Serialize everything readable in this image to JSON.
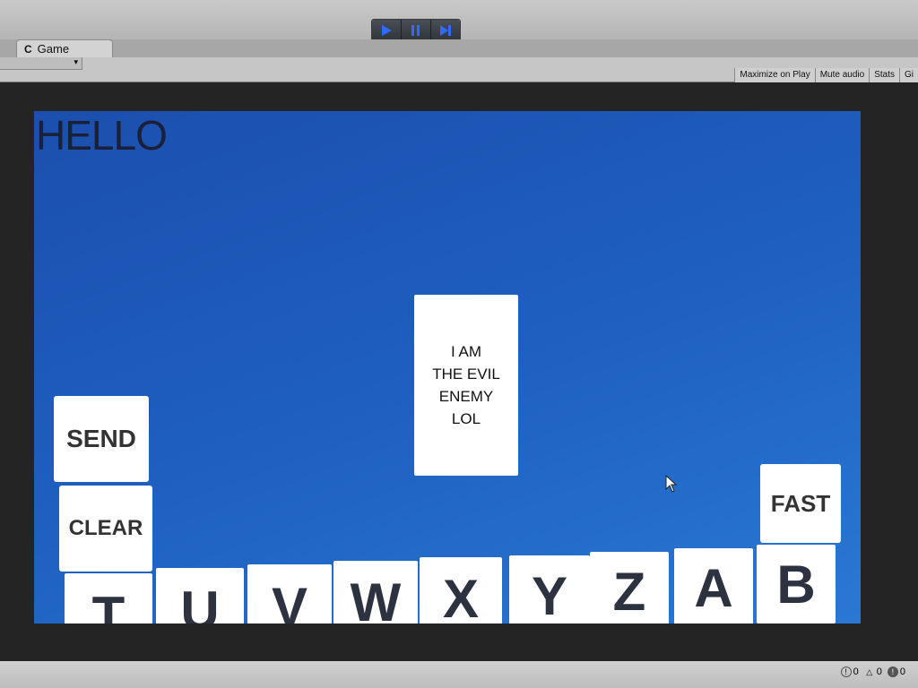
{
  "editor": {
    "tab_label": "Game",
    "toolbar": {
      "aspect_dropdown": "",
      "buttons": [
        "Maximize on Play",
        "Mute audio",
        "Stats",
        "Gi"
      ]
    },
    "play_controls": [
      "play-icon",
      "pause-icon",
      "step-icon"
    ],
    "status_counts": {
      "info": "0",
      "warnings": "0",
      "errors": "0"
    },
    "colors": {
      "accent": "#2f6bff",
      "viewport_top": "#1c4fae",
      "viewport_bottom": "#2b78d4"
    }
  },
  "game": {
    "hello_text": "HELLO",
    "enemy_text": "I AM\nTHE EVIL\nENEMY\nLOL",
    "send_label": "SEND",
    "clear_label": "CLEAR",
    "fast_label": "FAST",
    "letters": [
      "T",
      "U",
      "V",
      "W",
      "X",
      "Y",
      "Z",
      "A",
      "B"
    ]
  }
}
